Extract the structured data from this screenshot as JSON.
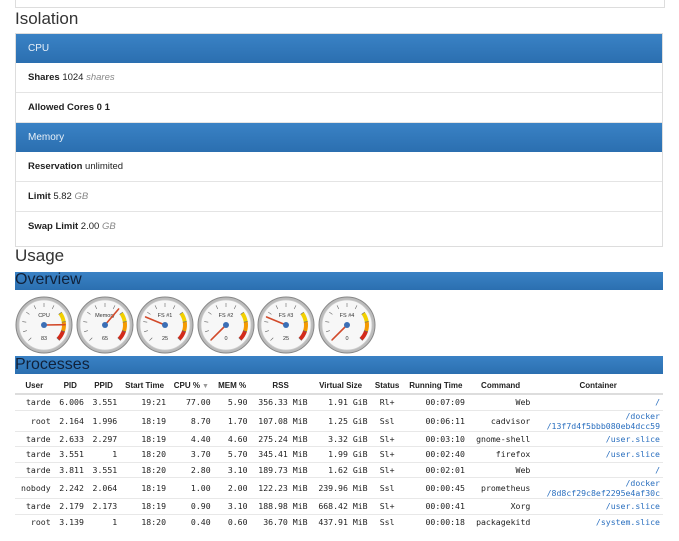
{
  "isolation": {
    "title": "Isolation",
    "cpu_header": "CPU",
    "shares_label": "Shares",
    "shares_value": "1024",
    "shares_unit": "shares",
    "cores_label": "Allowed Cores",
    "cores_value": "0 1",
    "memory_header": "Memory",
    "reservation_label": "Reservation",
    "reservation_value": "unlimited",
    "limit_label": "Limit",
    "limit_value": "5.82",
    "limit_unit": "GB",
    "swap_label": "Swap Limit",
    "swap_value": "2.00",
    "swap_unit": "GB"
  },
  "usage": {
    "title": "Usage",
    "overview": "Overview",
    "processes": "Processes"
  },
  "gauges": [
    {
      "label": "CPU",
      "value": "83",
      "level": 0.83
    },
    {
      "label": "Memory",
      "value": "65",
      "level": 0.65
    },
    {
      "label": "FS #1",
      "value": "25",
      "level": 0.25
    },
    {
      "label": "FS #2",
      "value": "0",
      "level": 0.0
    },
    {
      "label": "FS #3",
      "value": "25",
      "level": 0.25
    },
    {
      "label": "FS #4",
      "value": "0",
      "level": 0.0
    }
  ],
  "columns": [
    "User",
    "PID",
    "PPID",
    "Start Time",
    "CPU %",
    "MEM %",
    "RSS",
    "Virtual Size",
    "Status",
    "Running Time",
    "Command",
    "Container"
  ],
  "sort_icon": "▼",
  "rows": [
    [
      "tarde",
      "6.006",
      "3.551",
      "19:21",
      "77.00",
      "5.90",
      "356.33 MiB",
      "1.91 GiB",
      "Rl+",
      "00:07:09",
      "Web",
      "/",
      ""
    ],
    [
      "root",
      "2.164",
      "1.996",
      "18:19",
      "8.70",
      "1.70",
      "107.08 MiB",
      "1.25 GiB",
      "Ssl",
      "00:06:11",
      "cadvisor",
      "/docker",
      "/13f7d4f5bbb080eb4dcc59"
    ],
    [
      "tarde",
      "2.633",
      "2.297",
      "18:19",
      "4.40",
      "4.60",
      "275.24 MiB",
      "3.32 GiB",
      "Sl+",
      "00:03:10",
      "gnome-shell",
      "/user.slice",
      ""
    ],
    [
      "tarde",
      "3.551",
      "1",
      "18:20",
      "3.70",
      "5.70",
      "345.41 MiB",
      "1.99 GiB",
      "Sl+",
      "00:02:40",
      "firefox",
      "/user.slice",
      ""
    ],
    [
      "tarde",
      "3.811",
      "3.551",
      "18:20",
      "2.80",
      "3.10",
      "189.73 MiB",
      "1.62 GiB",
      "Sl+",
      "00:02:01",
      "Web",
      "/",
      ""
    ],
    [
      "nobody",
      "2.242",
      "2.064",
      "18:19",
      "1.00",
      "2.00",
      "122.23 MiB",
      "239.96 MiB",
      "Ssl",
      "00:00:45",
      "prometheus",
      "/docker",
      "/8d8cf29c8ef2295e4af30c"
    ],
    [
      "tarde",
      "2.179",
      "2.173",
      "18:19",
      "0.90",
      "3.10",
      "188.98 MiB",
      "668.42 MiB",
      "Sl+",
      "00:00:41",
      "Xorg",
      "/user.slice",
      ""
    ],
    [
      "root",
      "3.139",
      "1",
      "18:20",
      "0.40",
      "0.60",
      "36.70 MiB",
      "437.91 MiB",
      "Ssl",
      "00:00:18",
      "packagekitd",
      "/system.slice",
      ""
    ]
  ]
}
